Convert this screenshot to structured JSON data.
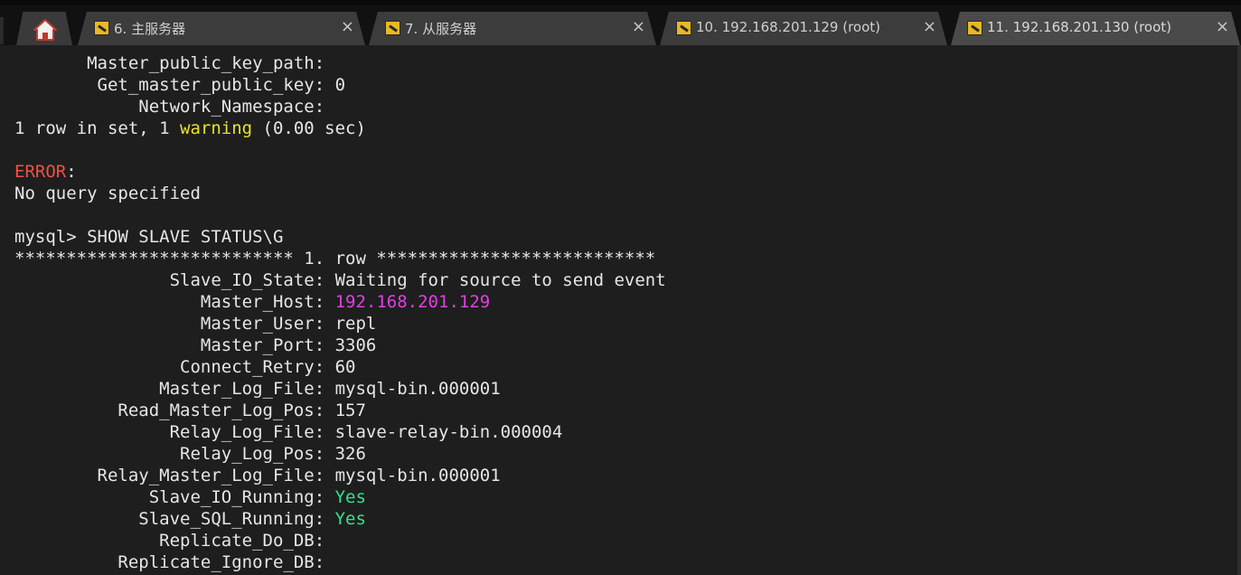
{
  "tabs": [
    {
      "label": "6. 主服务器",
      "close": "×"
    },
    {
      "label": "7. 从服务器",
      "close": "×"
    },
    {
      "label": "10. 192.168.201.129 (root)",
      "close": "×"
    },
    {
      "label": "11. 192.168.201.130 (root)",
      "close": "×",
      "active": true
    }
  ],
  "colors": {
    "warning": "#e8e12a",
    "error": "#f0504a",
    "host": "#e33ee6",
    "yes": "#36e08a",
    "text": "#e6e6e6",
    "background": "#1e1e1e"
  },
  "terminal": {
    "l1": "       Master_public_key_path:",
    "l2_key": "        Get_master_public_key:",
    "l2_val": " 0",
    "l3": "            Network_Namespace:",
    "l4_a": "1 row in set, 1 ",
    "l4_warn": "warning",
    "l4_b": " (0.00 sec)",
    "l6_err": "ERROR",
    "l6_colon": ":",
    "l7": "No query specified",
    "l9": "mysql> SHOW SLAVE STATUS\\G",
    "l10": "*************************** 1. row ***************************",
    "fields": [
      {
        "key": "               Slave_IO_State:",
        "val": " Waiting for source to send event",
        "style": ""
      },
      {
        "key": "                  Master_Host:",
        "val": " 192.168.201.129",
        "style": "c-magenta"
      },
      {
        "key": "                  Master_User:",
        "val": " repl",
        "style": ""
      },
      {
        "key": "                  Master_Port:",
        "val": " 3306",
        "style": ""
      },
      {
        "key": "                Connect_Retry:",
        "val": " 60",
        "style": ""
      },
      {
        "key": "              Master_Log_File:",
        "val": " mysql-bin.000001",
        "style": ""
      },
      {
        "key": "          Read_Master_Log_Pos:",
        "val": " 157",
        "style": ""
      },
      {
        "key": "               Relay_Log_File:",
        "val": " slave-relay-bin.000004",
        "style": ""
      },
      {
        "key": "                Relay_Log_Pos:",
        "val": " 326",
        "style": ""
      },
      {
        "key": "        Relay_Master_Log_File:",
        "val": " mysql-bin.000001",
        "style": ""
      },
      {
        "key": "             Slave_IO_Running:",
        "val": " Yes",
        "style": "c-green"
      },
      {
        "key": "            Slave_SQL_Running:",
        "val": " Yes",
        "style": "c-green"
      },
      {
        "key": "              Replicate_Do_DB:",
        "val": "",
        "style": ""
      },
      {
        "key": "          Replicate_Ignore_DB:",
        "val": "",
        "style": ""
      }
    ]
  }
}
